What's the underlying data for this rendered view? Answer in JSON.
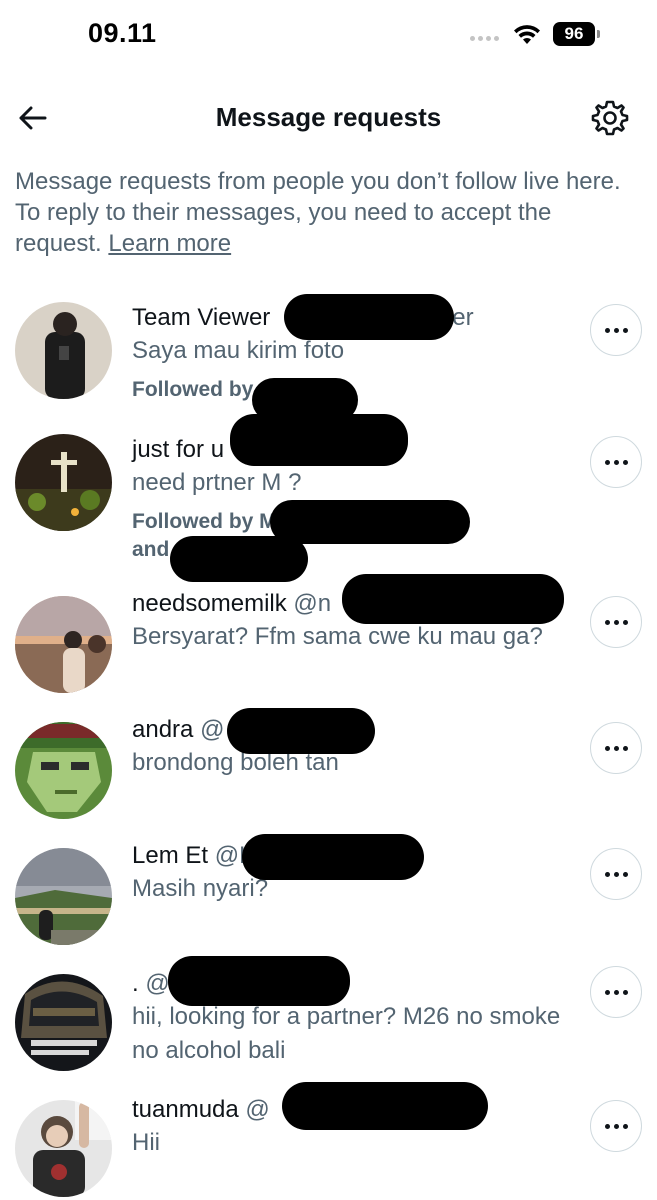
{
  "status_bar": {
    "time": "09.11",
    "battery": "96"
  },
  "header": {
    "title": "Message requests"
  },
  "intro": {
    "text": "Message requests from people you don’t follow live here. To reply to their messages, you need to accept the request.",
    "learn_more": "Learn more"
  },
  "requests": [
    {
      "name": "Team Viewer",
      "handle": "ser",
      "preview": "Saya mau kirim foto",
      "followed": "Followed by",
      "followed2": ""
    },
    {
      "name": "just for u",
      "handle": "",
      "preview": "need prtner M ?",
      "followed": "Followed by M",
      "followed2": "and"
    },
    {
      "name": "needsomemilk",
      "handle": "@n",
      "preview": "Bersyarat? Ffm sama cwe ku mau ga?",
      "followed": "",
      "followed2": ""
    },
    {
      "name": "andra",
      "handle": "@",
      "preview": "brondong boleh tan",
      "followed": "",
      "followed2": ""
    },
    {
      "name": "Lem Et",
      "handle": "@L",
      "preview": "Masih nyari?",
      "followed": "",
      "followed2": ""
    },
    {
      "name": ".",
      "handle": "@",
      "preview": "hii, looking for a partner? M26 no smoke no alcohol bali",
      "followed": "",
      "followed2": ""
    },
    {
      "name": "tuanmuda",
      "handle": "@",
      "preview": "Hii",
      "followed": "",
      "followed2": ""
    }
  ],
  "icons": {
    "back": "arrow-left-icon",
    "settings": "gear-icon",
    "more": "more-horizontal-icon",
    "wifi": "wifi-icon",
    "battery": "battery-icon"
  },
  "colors": {
    "text_primary": "#0f1419",
    "text_secondary": "#536471",
    "border": "#cfd9de",
    "background": "#ffffff"
  }
}
